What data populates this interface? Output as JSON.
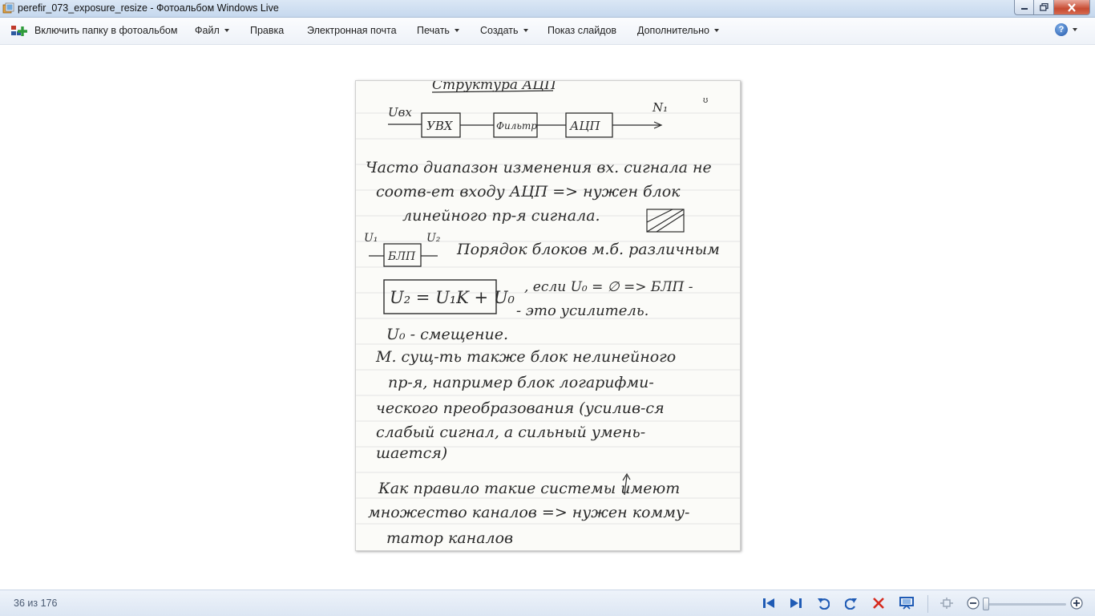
{
  "window": {
    "title": "perefir_073_exposure_resize - Фотоальбом Windows Live",
    "app_icon": "photo-gallery-icon",
    "buttons": [
      "minimize-icon",
      "maximize-icon",
      "close-icon"
    ]
  },
  "menubar": {
    "include_folder": "Включить папку в фотоальбом",
    "items": [
      {
        "label": "Файл",
        "dropdown": true
      },
      {
        "label": "Правка",
        "dropdown": false
      },
      {
        "label": "Электронная почта",
        "dropdown": false
      },
      {
        "label": "Печать",
        "dropdown": true
      },
      {
        "label": "Создать",
        "dropdown": true
      },
      {
        "label": "Показ слайдов",
        "dropdown": false
      },
      {
        "label": "Дополнительно",
        "dropdown": true
      }
    ],
    "help_glyph": "?"
  },
  "photo": {
    "description_lines": {
      "heading": "Структура АЦП",
      "block_uvx": "УВХ",
      "block_filter": "Фильтр",
      "block_adc": "АЦП",
      "input_label": "Uвх",
      "output_label": "N₁",
      "line1": "Часто диапазон изменения вх. сигнала не",
      "line2": "соотв-ет входу АЦП => нужен блок",
      "line3": "линейного пр-я сигнала.",
      "blp_in": "U₁",
      "blp_out": "U₂",
      "blp_block": "БЛП",
      "line4": "Порядок блоков м.б. различным",
      "formula": "U₂ = U₁K + U₀",
      "line5": ", если U₀ = ∅ => БЛП -",
      "line6": "- это усилитель.",
      "line7": "U₀ - смещение.",
      "line8": "М. сущ-ть также блок нелинейного",
      "line9": "пр-я, например блок логарифми-",
      "line10": "ческого преобразования (усилив-ся",
      "line11": "слабый сигнал, а сильный умень-",
      "line12": "шается)",
      "line13": "Как правило такие системы имеют",
      "line14": "множество каналов => нужен комму-",
      "line15": "татор каналов"
    }
  },
  "statusbar": {
    "counter": "36 из 176",
    "controls": [
      "previous-icon",
      "next-icon",
      "rotate-left-icon",
      "rotate-right-icon",
      "delete-icon",
      "slideshow-icon",
      "actual-size-icon",
      "zoom-out-icon",
      "zoom-in-icon"
    ],
    "zoom_level": 0.0
  }
}
